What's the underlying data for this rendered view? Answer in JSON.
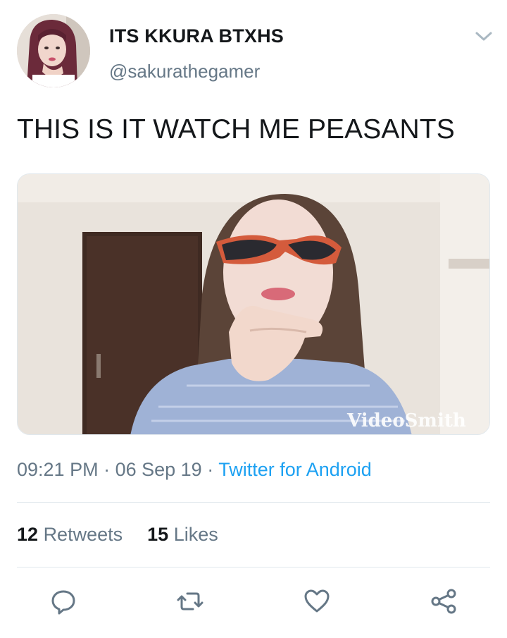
{
  "author": {
    "display_name": "ITS KKURA BTXHS",
    "handle": "@sakurathegamer"
  },
  "tweet": {
    "text": "THIS IS IT WATCH ME PEASANTS",
    "media_watermark": "VideoSmith"
  },
  "meta": {
    "time": "09:21 PM",
    "sep1": " · ",
    "date": "06 Sep 19",
    "sep2": " · ",
    "source": "Twitter for Android"
  },
  "stats": {
    "retweets_count": "12",
    "retweets_label": "Retweets",
    "likes_count": "15",
    "likes_label": "Likes"
  },
  "actions": [
    "reply-icon",
    "retweet-icon",
    "like-icon",
    "share-icon"
  ],
  "colors": {
    "link_blue": "#1da1f2",
    "muted_gray": "#657786",
    "divider": "#e1e8ed"
  }
}
